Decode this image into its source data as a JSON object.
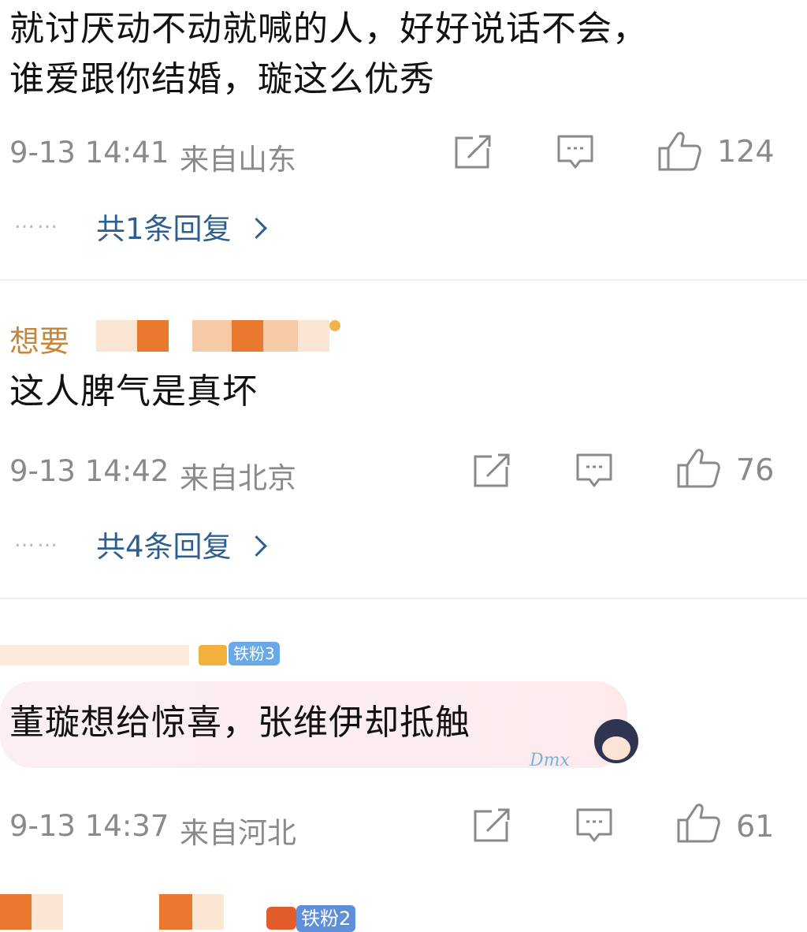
{
  "comments": [
    {
      "text_line1": "就讨厌动不动就喊的人，好好说话不会，",
      "text_line2": "谁爱跟你结婚，璇这么优秀",
      "time": "9-13 14:41",
      "location": "来自山东",
      "likes": "124",
      "replies": "共1条回复"
    },
    {
      "username_visible": "想要",
      "text": "这人脾气是真坏",
      "time": "9-13 14:42",
      "location": "来自北京",
      "likes": "76",
      "replies": "共4条回复"
    },
    {
      "badge": "铁粉3",
      "text": "董璇想给惊喜，张维伊却抵触",
      "time": "9-13 14:37",
      "location": "来自河北",
      "likes": "61"
    },
    {
      "badge": "铁粉2"
    }
  ],
  "reply_dots": "……",
  "sticker_text": "Dmx",
  "icons": [
    "share-icon",
    "comment-icon",
    "like-icon"
  ],
  "colors": {
    "link": "#2f5f8f",
    "meta": "#8a8a8a",
    "badge": "#6aa9e8",
    "blur_orange": "#e8782e"
  }
}
